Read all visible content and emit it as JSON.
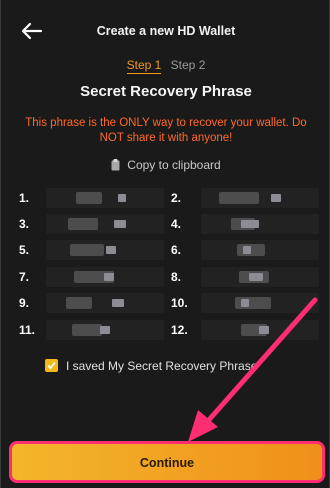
{
  "header": {
    "title": "Create a new HD Wallet"
  },
  "steps": {
    "step1": "Step 1",
    "step2": "Step 2"
  },
  "heading": "Secret Recovery Phrase",
  "warning": "This phrase is the ONLY way to recover your wallet. Do NOT share it with anyone!",
  "copy_label": "Copy to clipboard",
  "words": [
    {
      "num": "1."
    },
    {
      "num": "2."
    },
    {
      "num": "3."
    },
    {
      "num": "4."
    },
    {
      "num": "5."
    },
    {
      "num": "6."
    },
    {
      "num": "7."
    },
    {
      "num": "8."
    },
    {
      "num": "9."
    },
    {
      "num": "10."
    },
    {
      "num": "11."
    },
    {
      "num": "12."
    }
  ],
  "saved_label": "I saved My Secret Recovery Phrase",
  "continue_label": "Continue",
  "colors": {
    "accent": "#f29a1a",
    "warning": "#ff6a2a",
    "annotation": "#ff2d72",
    "background": "#1a1a1a"
  },
  "icons": {
    "back": "arrow-left-icon",
    "copy": "clipboard-icon",
    "check": "checkmark-icon"
  }
}
